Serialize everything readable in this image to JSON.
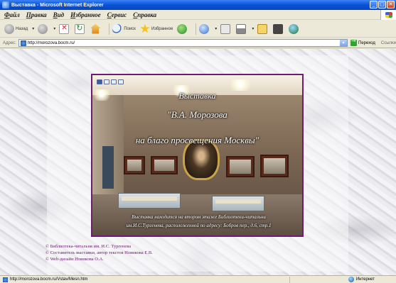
{
  "window": {
    "title": "Выставка - Microsoft Internet Explorer",
    "buttons": {
      "minimize": "_",
      "maximize": "□",
      "close": "✕"
    }
  },
  "menu": {
    "items": [
      "Файл",
      "Правка",
      "Вид",
      "Избранное",
      "Сервис",
      "Справка"
    ]
  },
  "toolbar": {
    "back_label": "Назад",
    "search_label": "Поиск",
    "favorites_label": "Избранное",
    "icons": [
      "back-icon",
      "forward-icon",
      "stop-icon",
      "refresh-icon",
      "home-icon",
      "search-icon",
      "favorites-icon",
      "media-icon",
      "history-icon",
      "mail-icon",
      "print-icon",
      "edit-icon",
      "discuss-icon",
      "research-icon",
      "messenger-icon"
    ]
  },
  "address": {
    "label": "Адрес:",
    "url": "http://morozova.bocm.ru/",
    "go_label": "Переход",
    "links_label": "Ссылки"
  },
  "page": {
    "caption": {
      "line1": "Выставка",
      "line2": "\"В.А. Морозова",
      "line3": "на благо просвещения Москвы\"",
      "line4a": "Выставка находится на втором этаже  Библиотеки-читальни",
      "line4b": "им.И.С.Тургенева, расположенной по адресу: Бобров пер., д.6, стр.1"
    },
    "credits": [
      "© Библиотека-читальня им. И.С. Тургенева",
      "© Составитель выставки, автор текстов Новикова Е.В.",
      "© Web-дизайн Новикова О.А."
    ]
  },
  "status": {
    "text": "http://morozova.bocm.ru/Vstav/Mesn.htm",
    "zone": "Интернет"
  },
  "colors": {
    "titlebar": "#0a52d6",
    "frame_border": "#6a1f6e",
    "credits_text": "#6a1a6e"
  }
}
